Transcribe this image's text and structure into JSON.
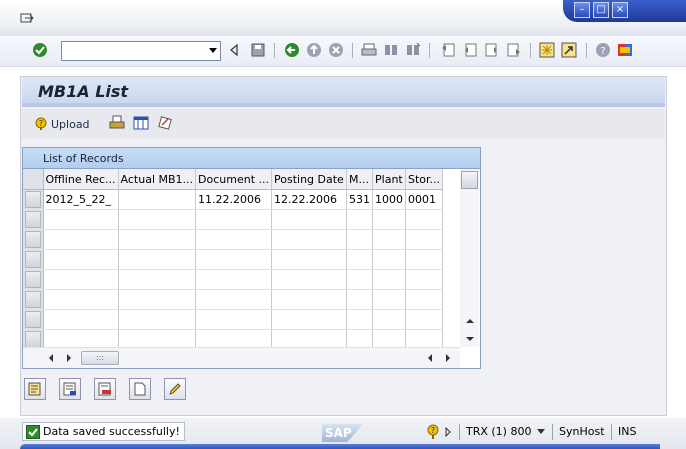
{
  "toolbar": {
    "command_value": "",
    "icons": [
      "enter-icon",
      "back-icon",
      "save-icon",
      "back-navigation-icon",
      "exit-icon",
      "cancel-icon",
      "print-icon",
      "find-icon",
      "find-next-icon",
      "first-page-icon",
      "previous-page-icon",
      "next-page-icon",
      "last-page-icon",
      "create-session-icon",
      "shortcut-icon",
      "help-icon",
      "customize-layout-icon"
    ]
  },
  "page": {
    "title": "MB1A List"
  },
  "app_toolbar": {
    "upload_label": "Upload",
    "icons": [
      "upload-icon",
      "print-icon",
      "layout-icon",
      "edit-icon"
    ]
  },
  "table": {
    "title": "List of Records",
    "columns": [
      "Offline Rec...",
      "Actual MB1...",
      "Document ...",
      "Posting Date",
      "M...",
      "Plant",
      "Stor..."
    ],
    "rows": [
      [
        "2012_5_22_",
        "",
        "11.22.2006",
        "12.22.2006",
        "531",
        "1000",
        "0001"
      ],
      [
        "",
        "",
        "",
        "",
        "",
        "",
        ""
      ],
      [
        "",
        "",
        "",
        "",
        "",
        "",
        ""
      ],
      [
        "",
        "",
        "",
        "",
        "",
        "",
        ""
      ],
      [
        "",
        "",
        "",
        "",
        "",
        "",
        ""
      ],
      [
        "",
        "",
        "",
        "",
        "",
        "",
        ""
      ],
      [
        "",
        "",
        "",
        "",
        "",
        "",
        ""
      ],
      [
        "",
        "",
        "",
        "",
        "",
        "",
        ""
      ]
    ]
  },
  "bottom_buttons": [
    "details-icon",
    "insert-row-icon",
    "delete-row-icon",
    "new-document-icon",
    "change-icon"
  ],
  "status": {
    "message": "Data saved successfully!",
    "logo_text": "SAP",
    "transaction": "TRX (1) 800",
    "host": "SynHost",
    "mode": "INS"
  },
  "colors": {
    "header_blue": "#c6d5ee",
    "table_title_blue": "#b2cdf0",
    "window_ctrl_blue": "#2b4bb8",
    "status_ok_green": "#2e8b2e"
  }
}
